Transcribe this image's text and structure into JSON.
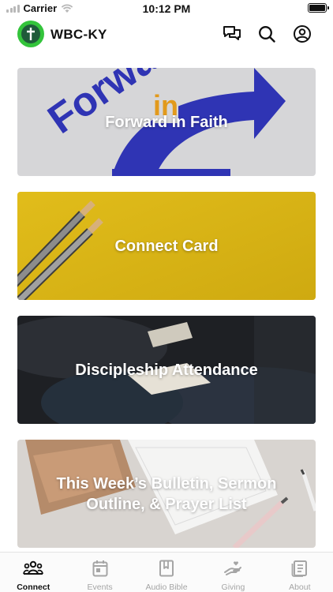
{
  "status_bar": {
    "carrier": "Carrier",
    "time": "10:12 PM"
  },
  "header": {
    "title": "WBC-KY",
    "icons": [
      "chat-icon",
      "search-icon",
      "account-icon"
    ]
  },
  "cards": [
    {
      "title": "Forward in Faith",
      "graphic_text": "Forward in Faith",
      "accent": "#2f34b4"
    },
    {
      "title": "Connect Card",
      "accent": "#d9b413"
    },
    {
      "title": "Discipleship Attendance",
      "accent": "#1e2024"
    },
    {
      "title": "This Week’s Bulletin, Sermon Outline, & Prayer List",
      "accent": "#d8d4d0"
    }
  ],
  "tabs": [
    {
      "label": "Connect",
      "icon": "people-icon",
      "active": true
    },
    {
      "label": "Events",
      "icon": "calendar-icon",
      "active": false
    },
    {
      "label": "Audio Bible",
      "icon": "book-icon",
      "active": false
    },
    {
      "label": "Giving",
      "icon": "hand-icon",
      "active": false
    },
    {
      "label": "About",
      "icon": "info-icon",
      "active": false
    }
  ],
  "colors": {
    "active_tab": "#111111",
    "inactive_tab": "#a5a5a5",
    "logo_green": "#33c43b"
  }
}
